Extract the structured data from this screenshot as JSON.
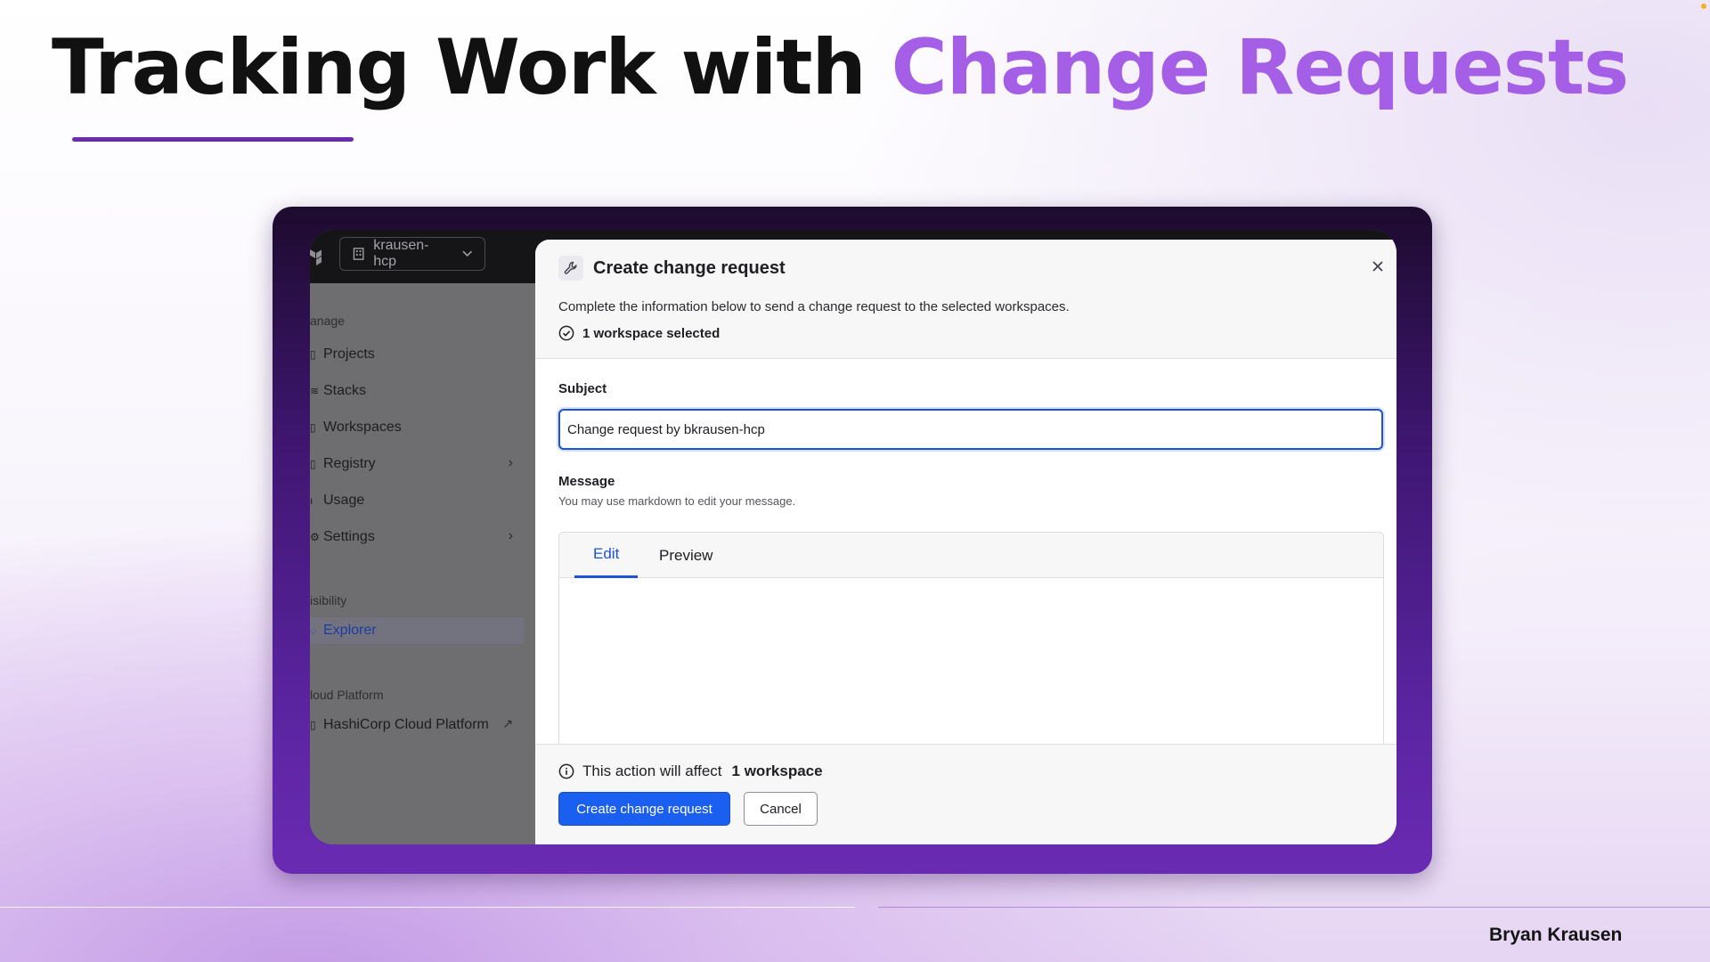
{
  "slide": {
    "title_part1": "Tracking Work with ",
    "title_part2": "Change Requests",
    "presenter": "Bryan Krausen",
    "accent_color": "#a45fe6"
  },
  "app": {
    "org_switcher": "krausen-hcp",
    "sidebar": {
      "section_manage": "anage",
      "items_manage": [
        {
          "label": "Projects",
          "icon": "file-icon"
        },
        {
          "label": "Stacks",
          "icon": "layers-icon"
        },
        {
          "label": "Workspaces",
          "icon": "workspace-icon"
        },
        {
          "label": "Registry",
          "icon": "registry-icon",
          "has_submenu": true
        },
        {
          "label": "Usage",
          "icon": "bar-icon"
        },
        {
          "label": "Settings",
          "icon": "gear-icon",
          "has_submenu": true
        }
      ],
      "section_visibility": "isibility",
      "explorer": "Explorer",
      "section_cloud": "loud Platform",
      "hcp_link": "HashiCorp Cloud Platform"
    }
  },
  "modal": {
    "title": "Create change request",
    "description": "Complete the information below to send a change request to the selected workspaces.",
    "selected_text": "1 workspace selected",
    "subject_label": "Subject",
    "subject_value": "Change request by bkrausen-hcp",
    "message_label": "Message",
    "message_help": "You may use markdown to edit your message.",
    "tabs": [
      "Edit",
      "Preview"
    ],
    "active_tab": "Edit",
    "impact_text": "This action will affect",
    "impact_count": "1 workspace",
    "primary_button": "Create change request",
    "cancel_button": "Cancel",
    "primary_color": "#1a5ff0"
  }
}
